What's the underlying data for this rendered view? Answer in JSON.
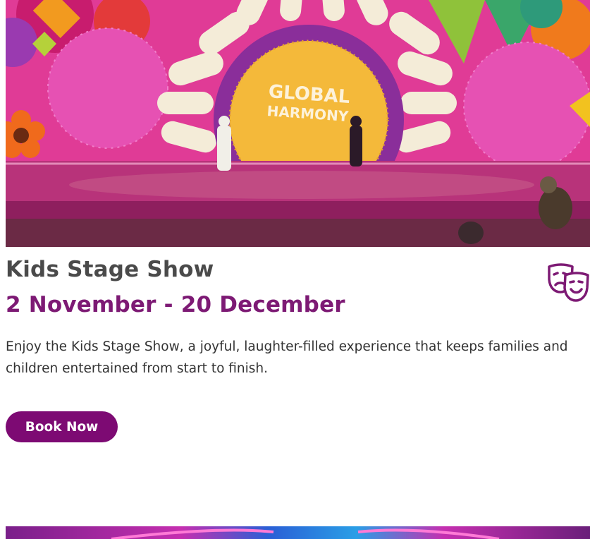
{
  "card": {
    "image": {
      "sign_line1": "GLOBAL",
      "sign_line2": "HARMONY"
    },
    "title": "Kids Stage Show",
    "date": "2 November - 20 December",
    "icon": "theater-masks-icon",
    "description": "Enjoy the Kids Stage Show, a joyful, laughter-filled experience that keeps families and children entertained from start to finish.",
    "book_label": "Book Now"
  },
  "colors": {
    "brand_purple": "#7d1a74",
    "button_purple": "#7d0a73",
    "title_gray": "#4a4a4a",
    "text": "#333333"
  }
}
